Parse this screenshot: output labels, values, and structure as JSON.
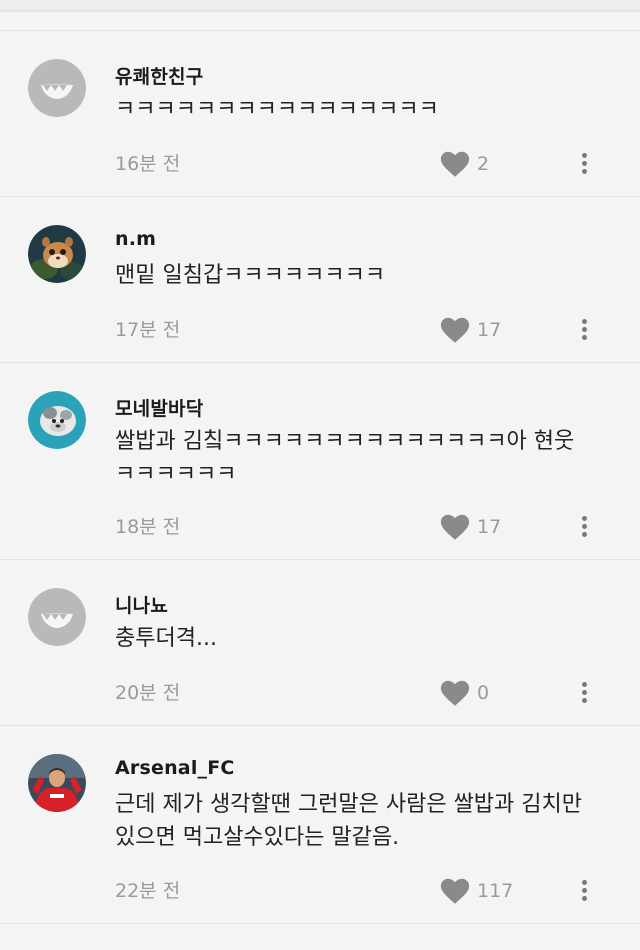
{
  "comments": [
    {
      "username": "유쾌한친구",
      "text": "ㅋㅋㅋㅋㅋㅋㅋㅋㅋㅋㅋㅋㅋㅋㅋㅋ",
      "time": "16분 전",
      "likes": "2",
      "avatar": "default-gray-face"
    },
    {
      "username": "n.m",
      "text": "맨밑 일침갑ㅋㅋㅋㅋㅋㅋㅋㅋ",
      "time": "17분 전",
      "likes": "17",
      "avatar": "cartoon-chipmunk"
    },
    {
      "username": "모네발바닥",
      "text": "쌀밥과 김칰ㅋㅋㅋㅋㅋㅋㅋㅋㅋㅋㅋㅋㅋㅋ아 현웃ㅋㅋㅋㅋㅋㅋ",
      "time": "18분 전",
      "likes": "17",
      "avatar": "dog-photo"
    },
    {
      "username": "니나뇨",
      "text": "충투더격...",
      "time": "20분 전",
      "likes": "0",
      "avatar": "default-gray-face"
    },
    {
      "username": "Arsenal_FC",
      "text": "근데 제가 생각할땐 그런말은 사람은 쌀밥과 김치만있으면 먹고살수있다는 말같음.",
      "time": "22분 전",
      "likes": "117",
      "avatar": "football-player-red"
    }
  ],
  "colors": {
    "background": "#f4f4f4",
    "divider": "#e2e2e2",
    "meta_text": "#9a9a9a",
    "heart": "#8a8a8a",
    "default_avatar": "#b9b9b9"
  }
}
